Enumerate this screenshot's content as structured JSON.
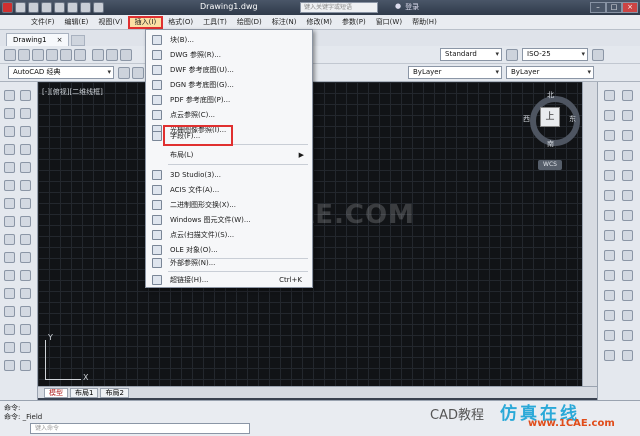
{
  "window": {
    "title": "Drawing1.dwg",
    "search_placeholder": "键入关键字或短语",
    "login": "登录"
  },
  "menubar": {
    "items": [
      "文件(F)",
      "编辑(E)",
      "视图(V)",
      "插入(I)",
      "格式(O)",
      "工具(T)",
      "绘图(D)",
      "标注(N)",
      "修改(M)",
      "参数(P)",
      "窗口(W)",
      "帮助(H)"
    ],
    "active_index": 3
  },
  "tabs": [
    {
      "label": "Drawing1",
      "close": "×"
    }
  ],
  "toolbar": {
    "workspace": "AutoCAD 经典",
    "text_style": "Standard",
    "dim_style": "ISO-25",
    "layer": "ByLayer",
    "linetype": "ByLayer"
  },
  "viewport": {
    "label": "[-][俯视][二维线框]",
    "viewcube": {
      "face": "上",
      "north": "北",
      "south": "南",
      "east": "东",
      "west": "西",
      "wcs": "WCS"
    },
    "ucs_x": "X",
    "ucs_y": "Y"
  },
  "layout_tabs": [
    "模型",
    "布局1",
    "布局2"
  ],
  "insert_menu": {
    "items": [
      {
        "label": "块(B)..."
      },
      {
        "label": "DWG 参照(R)..."
      },
      {
        "label": "DWF 参考底图(U)..."
      },
      {
        "label": "DGN 参考底图(G)..."
      },
      {
        "label": "PDF 参考底图(P)..."
      },
      {
        "label": "点云参照(C)..."
      },
      {
        "label": "光栅图像参照(I)..."
      },
      {
        "label": "字段(F)..."
      },
      {
        "label": "布局(L)",
        "submenu": true
      },
      {
        "label": "3D Studio(3)..."
      },
      {
        "label": "ACIS 文件(A)..."
      },
      {
        "label": "二进制图形交换(X)..."
      },
      {
        "label": "Windows 图元文件(W)..."
      },
      {
        "label": "点云(扫描文件)(S)..."
      },
      {
        "label": "OLE 对象(O)..."
      },
      {
        "label": "外部参照(N)..."
      },
      {
        "label": "超链接(H)...",
        "shortcut": "Ctrl+K"
      }
    ],
    "highlighted_index": 7
  },
  "command": {
    "line1": "命令:",
    "line2": "命令: _Field",
    "input_placeholder": "键入命令"
  },
  "watermark": {
    "site": "1CAE.COM",
    "channel": "CAD教程",
    "brand": "仿真在线",
    "url": "www.1CAE.com"
  },
  "colors": {
    "highlight_red": "#e03030",
    "brand_blue": "#2aa9d8",
    "brand_orange": "#e04c1a"
  }
}
